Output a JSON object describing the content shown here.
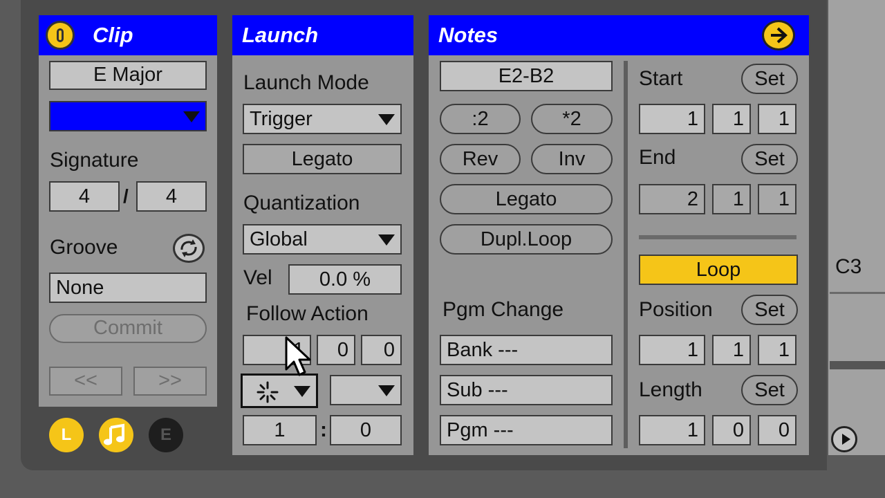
{
  "clip": {
    "title": "Clip",
    "name": "E Major",
    "signature_label": "Signature",
    "sig_num": "4",
    "sig_sep": "/",
    "sig_den": "4",
    "groove_label": "Groove",
    "groove_value": "None",
    "commit_label": "Commit",
    "prev_label": "<<",
    "next_label": ">>",
    "color_swatch": "#0000ff"
  },
  "toggles": {
    "l": "L",
    "e": "E"
  },
  "launch": {
    "title": "Launch",
    "mode_label": "Launch Mode",
    "mode_value": "Trigger",
    "legato_label": "Legato",
    "quant_label": "Quantization",
    "quant_value": "Global",
    "vel_label": "Vel",
    "vel_value": "0.0 %",
    "follow_label": "Follow Action",
    "follow_time": [
      "1",
      "0",
      "0"
    ],
    "follow_chance_a": "1",
    "follow_colon": ":",
    "follow_chance_b": "0"
  },
  "notes": {
    "title": "Notes",
    "range": "E2-B2",
    "half_label": ":2",
    "double_label": "*2",
    "rev_label": "Rev",
    "inv_label": "Inv",
    "legato_label": "Legato",
    "dupl_label": "Dupl.Loop",
    "pgm_change_label": "Pgm Change",
    "bank": "Bank ---",
    "sub": "Sub ---",
    "pgm": "Pgm ---",
    "start_label": "Start",
    "start_values": [
      "1",
      "1",
      "1"
    ],
    "end_label": "End",
    "end_values": [
      "2",
      "1",
      "1"
    ],
    "set_label": "Set",
    "loop_label": "Loop",
    "position_label": "Position",
    "position_values": [
      "1",
      "1",
      "1"
    ],
    "length_label": "Length",
    "length_values": [
      "1",
      "0",
      "0"
    ]
  },
  "editor": {
    "pitch_label": "C3"
  },
  "colors": {
    "header": "#0000ff",
    "accent": "#f5c518",
    "panel": "#969696"
  }
}
